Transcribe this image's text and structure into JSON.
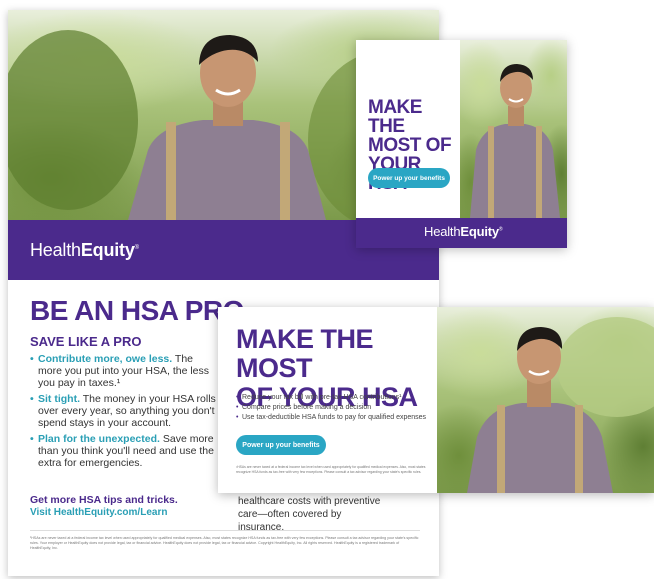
{
  "brand": {
    "name_light": "Health",
    "name_bold": "Equity",
    "trademark": "®",
    "colors": {
      "purple": "#4b2a8c",
      "teal": "#2aa6c4"
    }
  },
  "flyer": {
    "title": "BE AN HSA PRO",
    "subtitle": "SAVE LIKE A PRO",
    "bullets": [
      {
        "lead": "Contribute more, owe less.",
        "text": " The more you put into your HSA, the less you pay in taxes.¹"
      },
      {
        "lead": "Sit tight.",
        "text": " The money in your HSA rolls over every year, so anything you don't spend stays in your account."
      },
      {
        "lead": "Plan for the unexpected.",
        "text": " Save more than you think you'll need and use the extra for emergencies."
      }
    ],
    "partial_text": "healthcare costs with preventive care—often covered by insurance.",
    "tips": "Get more HSA tips and tricks.",
    "url": "Visit HealthEquity.com/Learn",
    "fine_print": "¹HSAs are never taxed at a federal income tax level when used appropriately for qualified medical expenses. Also, most states recognize HSA funds as tax-free with very few exceptions. Please consult a tax advisor regarding your state's specific rules. Your employer or HealthEquity does not provide legal, tax or financial advice. HealthEquity does not provide legal, tax or financial advice. Copyright HealthEquity, Inc. All rights reserved. HealthEquity is a registered trademark of HealthEquity, Inc."
  },
  "banner": {
    "headline": [
      "MAKE THE",
      "MOST OF",
      "YOUR HSA"
    ],
    "button": "Power up your benefits"
  },
  "email": {
    "headline": [
      "MAKE THE MOST",
      "OF YOUR HSA"
    ],
    "items": [
      "Reduce your tax bill with pre-tax HSA contributions¹",
      "Compare prices before making a decision",
      "Use tax-deductible HSA funds to pay for qualified expenses"
    ],
    "button": "Power up your benefits",
    "fine_print": "¹HSAs are never taxed at a federal income tax level when used appropriately for qualified medical expenses. Also, most states recognize HSA funds as tax-free with very few exceptions. Please consult a tax advisor regarding your state's specific rules."
  }
}
